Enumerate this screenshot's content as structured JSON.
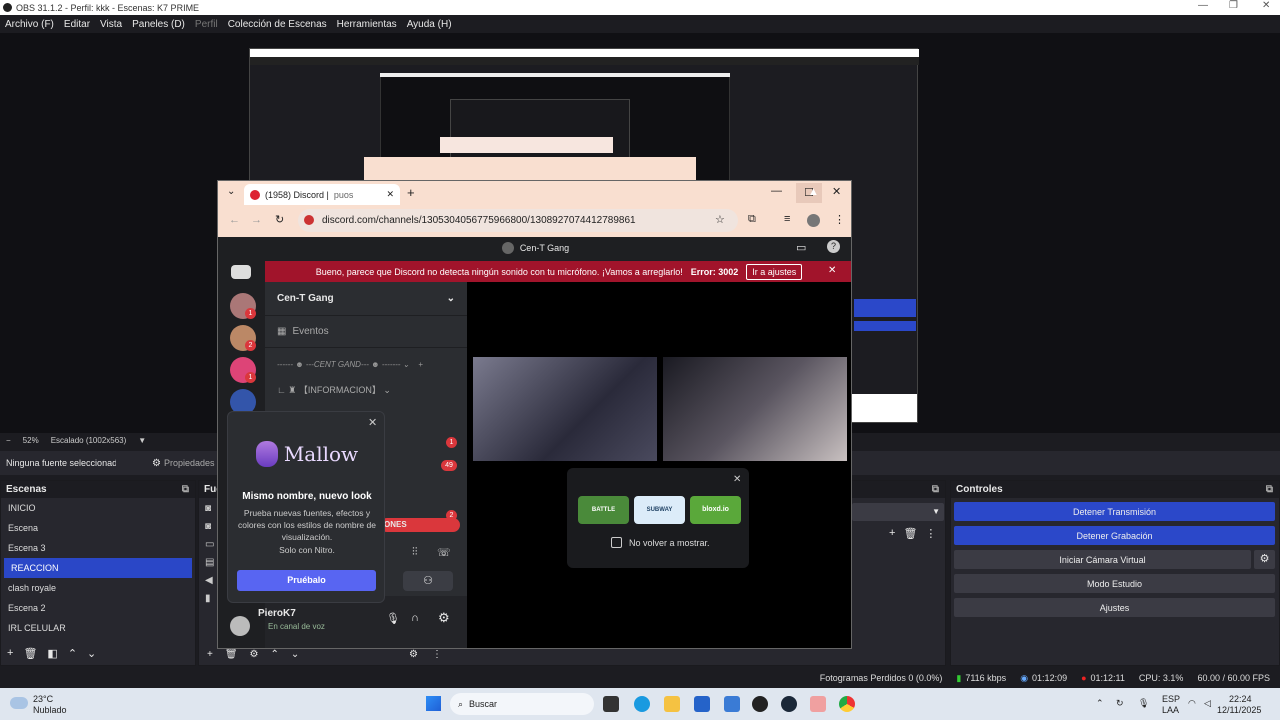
{
  "window": {
    "title": "OBS 31.1.2 - Perfil: kkk - Escenas: K7 PRIME"
  },
  "menu": {
    "items": [
      "Archivo (F)",
      "Editar",
      "Vista",
      "Paneles (D)"
    ],
    "disabled": "Perfil",
    "items2": [
      "Colección de Escenas",
      "Herramientas",
      "Ayuda (H)"
    ]
  },
  "preview": {
    "zoom": "52%",
    "scale": "Escalado (1002x563)"
  },
  "sources_bar": {
    "no_source": "Ninguna fuente seleccionada",
    "properties": "Propiedades"
  },
  "scenes": {
    "title": "Escenas",
    "items": [
      "INICIO",
      "Escena",
      "Escena 3",
      "REACCION",
      "clash royale",
      "Escena 2",
      "IRL CELULAR"
    ],
    "selected": "REACCION"
  },
  "sources": {
    "title_partial": "Fue"
  },
  "controls": {
    "title": "Controles",
    "buttons": [
      "Detener Transmisión",
      "Detener Grabación",
      "Iniciar Cámara Virtual",
      "Modo Estudio",
      "Ajustes"
    ]
  },
  "status": {
    "dropped": "Fotogramas Perdidos 0 (0.0%)",
    "bitrate": "7116 kbps",
    "stream_time": "01:12:09",
    "rec_time": "01:12:11",
    "cpu": "CPU: 3.1%",
    "fps": "60.00 / 60.00 FPS"
  },
  "chrome": {
    "tab_title": "(1958) Discord |",
    "tab_extra": "puos",
    "url": "discord.com/channels/1305304056775966800/1308927074412789861"
  },
  "discord": {
    "channel": "Cen-T Gang",
    "banner_text": "Bueno, parece que Discord no detecta ningún sonido con tu micrófono. ¡Vamos a arreglarlo!",
    "banner_error": "Error: 3002",
    "banner_btn": "Ir a ajustes",
    "server": "Cen-T Gang",
    "events": "Eventos",
    "category": "CENT GAND",
    "info": "【INFORMACION】",
    "user": "PieroK7",
    "user_status": "En canal de voz",
    "join_label": "ONES",
    "badge_counts": [
      "1",
      "2",
      "1"
    ],
    "channel_badges": [
      "1",
      "49",
      "2"
    ],
    "dismiss": "No volver a mostrar.",
    "games": [
      "BATTLE",
      "SUBWAY",
      "bloxd.io"
    ]
  },
  "popup": {
    "brand": "Mallow",
    "heading": "Mismo nombre, nuevo look",
    "body": "Prueba nuevas fuentes, efectos y colores con los estilos de nombre de visualización.",
    "nitro": "Solo con Nitro.",
    "button": "Pruébalo"
  },
  "taskbar": {
    "weather_temp": "23°C",
    "weather_desc": "Nublado",
    "search": "Buscar",
    "lang1": "ESP",
    "lang2": "LAA",
    "time": "22:24",
    "date": "12/11/2025"
  }
}
